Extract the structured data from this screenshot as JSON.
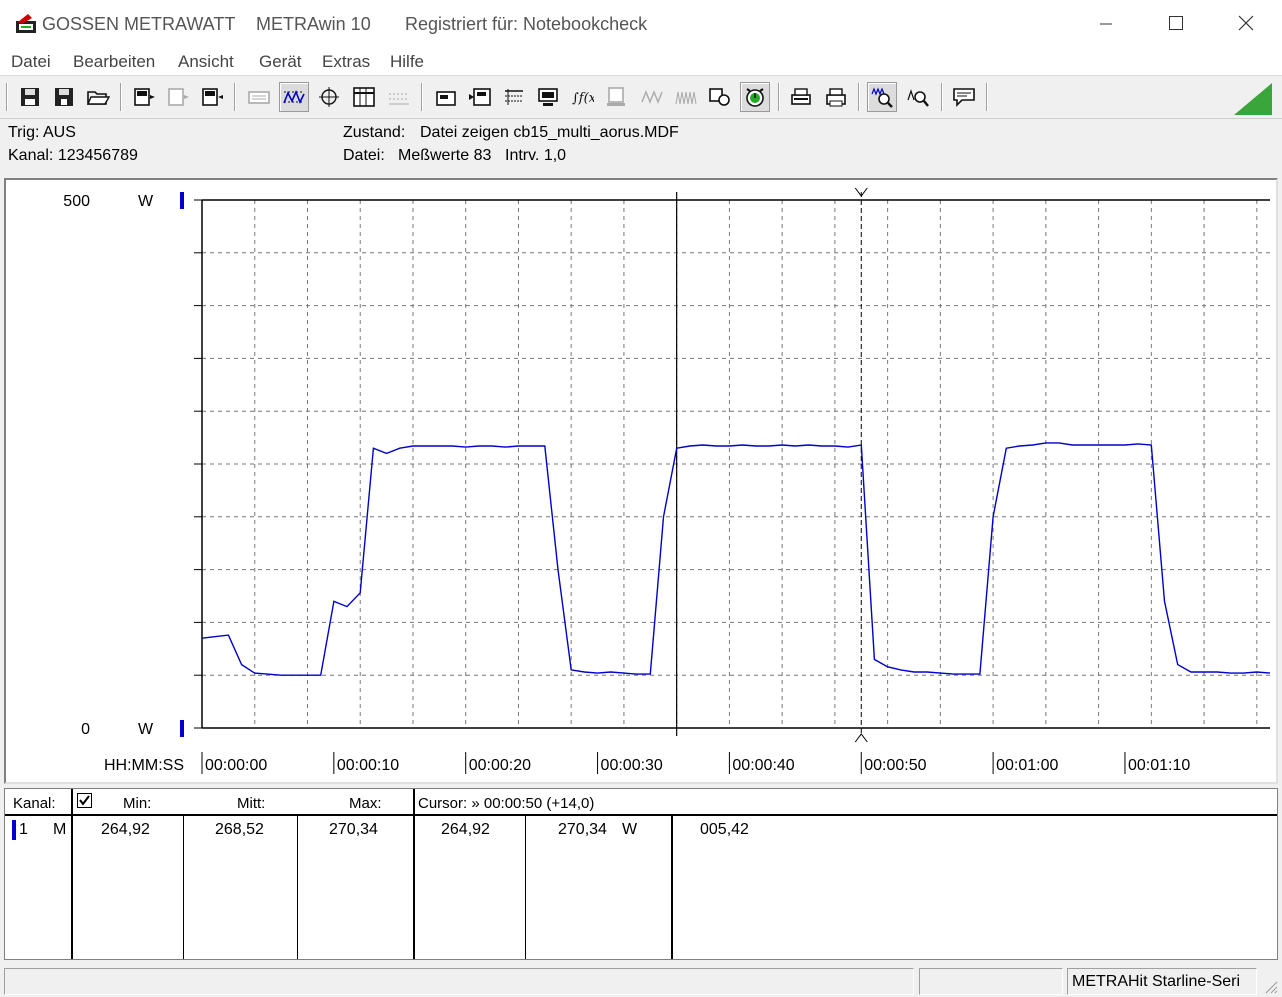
{
  "titlebar": {
    "brand": "GOSSEN METRAWATT",
    "app": "METRAwin 10",
    "registered": "Registriert für: Notebookcheck"
  },
  "menu": [
    "Datei",
    "Bearbeiten",
    "Ansicht",
    "Gerät",
    "Extras",
    "Hilfe"
  ],
  "info": {
    "trig": "Trig: AUS",
    "kanal": "Kanal: 123456789",
    "zustand_label": "Zustand:",
    "zustand_value": "Datei zeigen cb15_multi_aorus.MDF",
    "datei_label": "Datei:",
    "datei_value": "Meßwerte 83",
    "intrv": "Intrv. 1,0"
  },
  "chart_data": {
    "type": "line",
    "y_top_label": "500",
    "y_bottom_label": "0",
    "y_unit": "W",
    "ylim": [
      0,
      500
    ],
    "x_axis_label": "HH:MM:SS",
    "x_tick_labels": [
      "00:00:00",
      "00:00:10",
      "00:00:20",
      "00:00:30",
      "00:00:40",
      "00:00:50",
      "00:01:00",
      "00:01:10"
    ],
    "xlim": [
      0,
      81
    ],
    "grid": true,
    "cursor_1_x": 36,
    "cursor_2_x": 50,
    "series": [
      {
        "color": "#0000cc",
        "x": [
          0,
          2,
          3,
          4,
          6,
          7,
          8,
          9,
          10,
          11,
          12,
          13,
          14,
          15,
          16,
          17,
          18,
          19,
          20,
          21,
          22,
          23,
          24,
          25,
          26,
          27,
          28,
          29,
          30,
          31,
          32,
          33,
          34,
          35,
          36,
          37,
          38,
          39,
          40,
          41,
          42,
          43,
          44,
          45,
          46,
          47,
          48,
          49,
          50,
          51,
          52,
          53,
          54,
          55,
          56,
          57,
          58,
          59,
          60,
          61,
          62,
          63,
          64,
          65,
          66,
          67,
          68,
          69,
          70,
          71,
          72,
          73,
          74,
          75,
          76,
          77,
          78,
          79,
          80,
          81
        ],
        "y": [
          85,
          88,
          60,
          52,
          50,
          50,
          50,
          50,
          120,
          115,
          128,
          265,
          260,
          265,
          267,
          267,
          267,
          267,
          266,
          267,
          267,
          266,
          267,
          267,
          267,
          150,
          55,
          53,
          52,
          53,
          52,
          51,
          51,
          200,
          265,
          267,
          268,
          267,
          267,
          268,
          267,
          267,
          268,
          267,
          268,
          267,
          267,
          266,
          268,
          65,
          58,
          55,
          53,
          53,
          52,
          51,
          51,
          51,
          200,
          265,
          267,
          268,
          270,
          270,
          268,
          268,
          268,
          268,
          268,
          269,
          268,
          120,
          60,
          53,
          53,
          53,
          52,
          52,
          53,
          52
        ]
      }
    ]
  },
  "table": {
    "kanal_header": "Kanal:",
    "min_header": "Min:",
    "mitt_header": "Mitt:",
    "max_header": "Max:",
    "cursor_header": "Cursor: » 00:00:50 (+14,0)",
    "row": {
      "channel": "1",
      "mode": "M",
      "min": "264,92",
      "mitt": "268,52",
      "max": "270,34",
      "cursor_a": "264,92",
      "cursor_b": "270,34",
      "unit": "W",
      "diff": "005,42"
    }
  },
  "statusbar": {
    "right": "METRAHit Starline-Seri"
  },
  "colors": {
    "trace": "#0000cc",
    "grid": "#808080",
    "accent_triangle": "#3aa53a"
  }
}
